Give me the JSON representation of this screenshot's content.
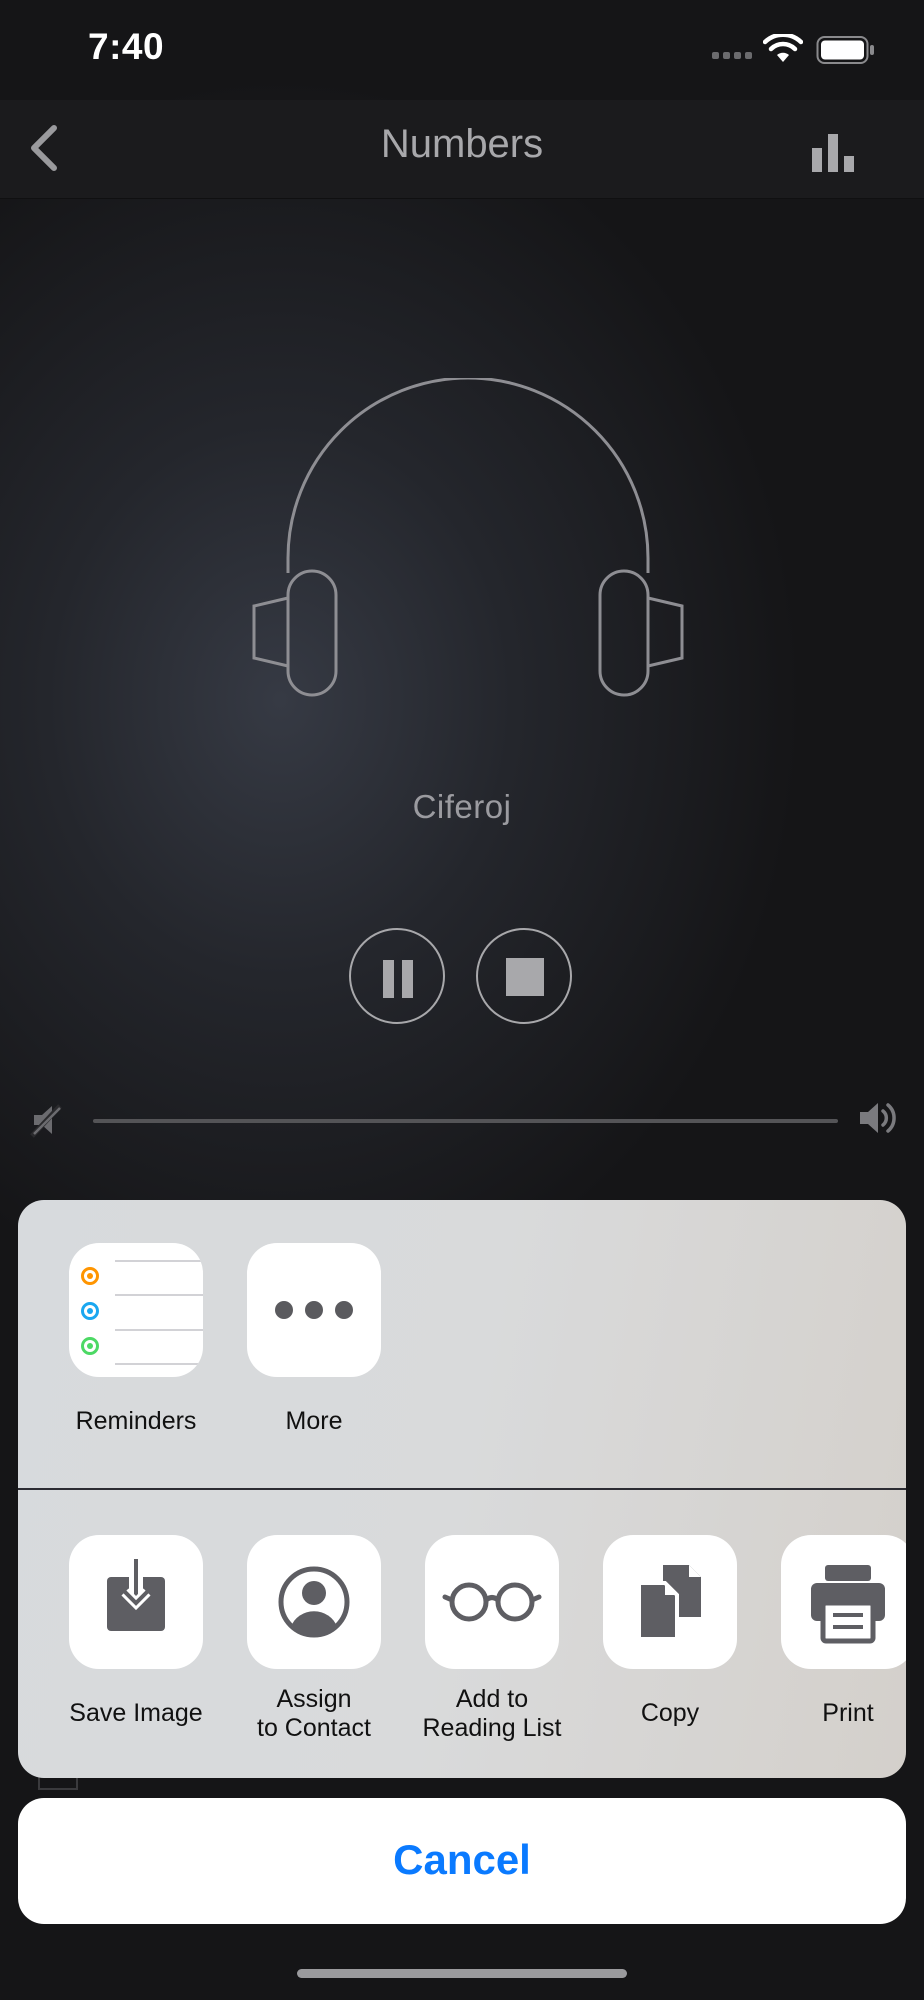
{
  "status_bar": {
    "time": "7:40"
  },
  "nav": {
    "title": "Numbers"
  },
  "player": {
    "track_title": "Ciferoj",
    "volume": 1.0
  },
  "share_sheet": {
    "apps": [
      {
        "label": "Reminders",
        "icon": "reminders-icon"
      },
      {
        "label": "More",
        "icon": "more-icon"
      }
    ],
    "actions": [
      {
        "label": "Save Image",
        "icon": "save-image-icon"
      },
      {
        "label": "Assign\nto Contact",
        "icon": "contact-icon"
      },
      {
        "label": "Add to\nReading List",
        "icon": "reading-list-icon"
      },
      {
        "label": "Copy",
        "icon": "copy-icon"
      },
      {
        "label": "Print",
        "icon": "print-icon"
      }
    ],
    "cancel_label": "Cancel"
  },
  "colors": {
    "accent": "#0a7aff",
    "reminder_orange": "#ff9500",
    "reminder_blue": "#1aa7f0",
    "reminder_green": "#4cd964"
  }
}
